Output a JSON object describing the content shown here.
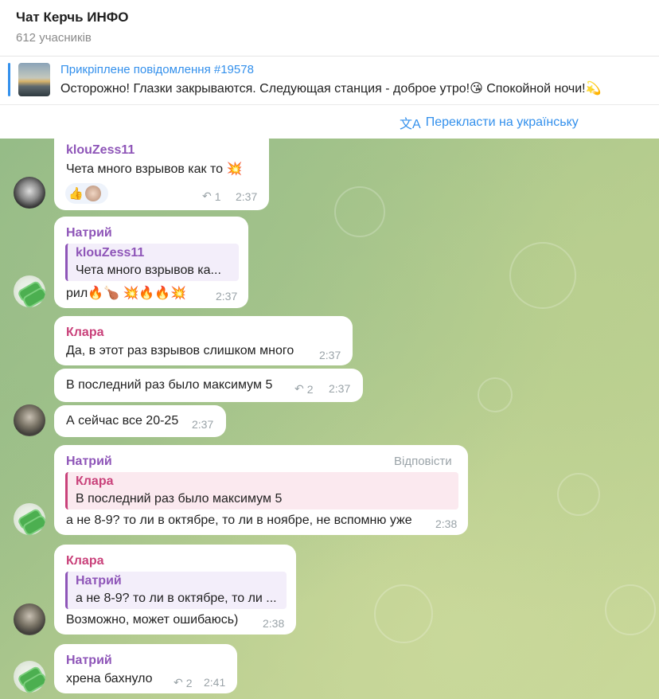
{
  "header": {
    "title": "Чат Керчь ИНФО",
    "subtitle": "612 учасників"
  },
  "pinned": {
    "title": "Прикріплене повідомлення #19578",
    "text": "Осторожно! Глазки закрываются. Следующая станция - доброе утро!😘  Спокойной ночи!💫"
  },
  "translate": {
    "label": "Перекласти на українську",
    "icon": "translate-icon"
  },
  "colors": {
    "accent": "#3390ec",
    "klouzess": "#8e55b8",
    "natriy": "#8e55b8",
    "klara": "#c9417a"
  },
  "messages": [
    {
      "author": "klouZess11",
      "text": "Чета много взрывов как то  💥",
      "reactions": "👍",
      "replies": "1",
      "time": "2:37"
    },
    {
      "author": "Натрий",
      "quote_author": "klouZess11",
      "quote_text": "Чета много взрывов ка...",
      "text": "рил🔥🍗 💥🔥🔥💥",
      "time": "2:37"
    },
    {
      "author": "Клара",
      "text": "Да, в этот раз взрывов слишком много",
      "time": "2:37"
    },
    {
      "text": "В последний раз было максимум 5",
      "replies": "2",
      "time": "2:37"
    },
    {
      "text": "А сейчас все 20-25",
      "time": "2:37"
    },
    {
      "author": "Натрий",
      "reply_label": "Відповісти",
      "quote_author": "Клара",
      "quote_text": "В последний раз было максимум 5",
      "text": "а не 8-9? то ли в октябре, то ли в ноябре, не вспомню уже",
      "time": "2:38"
    },
    {
      "author": "Клара",
      "quote_author": "Натрий",
      "quote_text": "а не 8-9? то ли в октябре, то ли ...",
      "text": "Возможно, может ошибаюсь)",
      "time": "2:38"
    },
    {
      "author": "Натрий",
      "text": "хрена бахнуло",
      "replies": "2",
      "time": "2:41"
    }
  ]
}
